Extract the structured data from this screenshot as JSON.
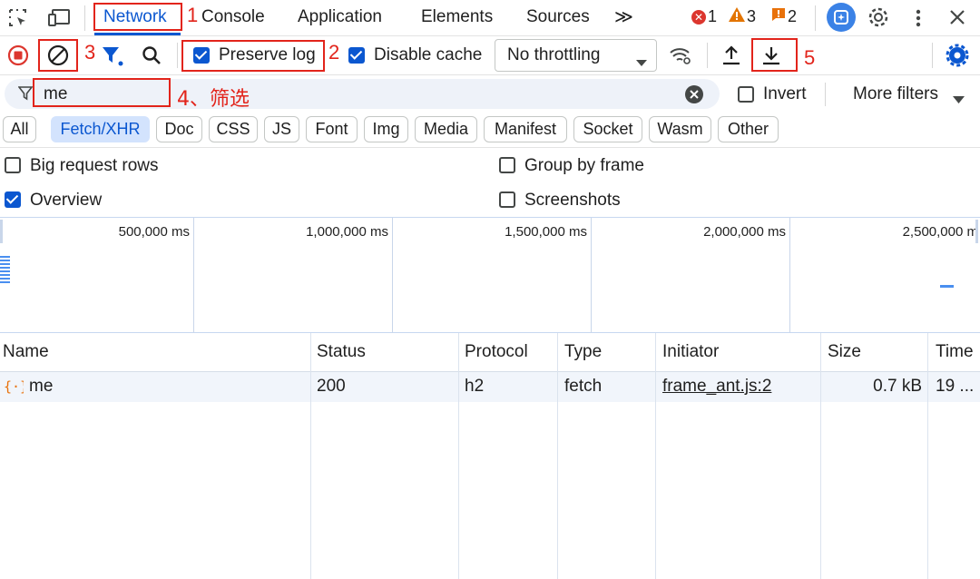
{
  "tabs": {
    "network": "Network",
    "console": "Console",
    "application": "Application",
    "elements": "Elements",
    "sources": "Sources",
    "more": "≫"
  },
  "counters": {
    "errors": "1",
    "warnings": "3",
    "issues": "2",
    "error_color": "#dc362e",
    "warning_color": "#e37400",
    "issue_color": "#e8710a"
  },
  "toolbar": {
    "preserve_log": "Preserve log",
    "preserve_log_checked": true,
    "disable_cache": "Disable cache",
    "disable_cache_checked": true,
    "throttling": "No throttling"
  },
  "filter": {
    "value": "me",
    "invert": "Invert",
    "more_filters": "More filters"
  },
  "type_filters": [
    "All",
    "Fetch/XHR",
    "Doc",
    "CSS",
    "JS",
    "Font",
    "Img",
    "Media",
    "Manifest",
    "Socket",
    "Wasm",
    "Other"
  ],
  "active_type_filter": "Fetch/XHR",
  "settings": {
    "big_request_rows": "Big request rows",
    "group_by_frame": "Group by frame",
    "overview": "Overview",
    "screenshots": "Screenshots"
  },
  "overview_ticks": [
    "500,000 ms",
    "1,000,000 ms",
    "1,500,000 ms",
    "2,000,000 ms",
    "2,500,000 m"
  ],
  "columns": [
    "Name",
    "Status",
    "Protocol",
    "Type",
    "Initiator",
    "Size",
    "Time"
  ],
  "rows": [
    {
      "name": "me",
      "status": "200",
      "protocol": "h2",
      "type": "fetch",
      "initiator": "frame_ant.js:2",
      "size": "0.7 kB",
      "time": "19 ..."
    }
  ],
  "annotations": {
    "a1": "1",
    "a2": "2",
    "a3": "3",
    "a4": "4、筛选",
    "a5": "5",
    "color": "#e2241b"
  },
  "accent": "#0b57d0"
}
